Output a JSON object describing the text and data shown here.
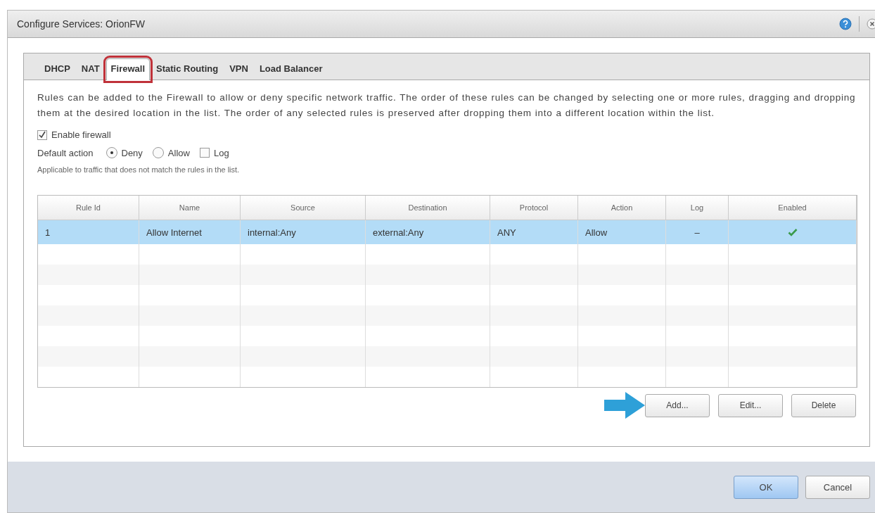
{
  "window": {
    "title": "Configure Services: OrionFW"
  },
  "tabs": [
    {
      "label": "DHCP",
      "selected": false,
      "highlighted": false
    },
    {
      "label": "NAT",
      "selected": false,
      "highlighted": false
    },
    {
      "label": "Firewall",
      "selected": true,
      "highlighted": true
    },
    {
      "label": "Static Routing",
      "selected": false,
      "highlighted": false
    },
    {
      "label": "VPN",
      "selected": false,
      "highlighted": false
    },
    {
      "label": "Load Balancer",
      "selected": false,
      "highlighted": false
    }
  ],
  "description": "Rules can be added to the Firewall to allow or deny specific network traffic. The order of these rules can be changed by selecting one or more rules, dragging and dropping them at the desired location in the list. The order of any selected rules is preserved after dropping them into a different location within the list.",
  "enable_firewall": {
    "label": "Enable firewall",
    "checked": true
  },
  "default_action": {
    "label": "Default action",
    "options": [
      {
        "label": "Deny",
        "selected": true
      },
      {
        "label": "Allow",
        "selected": false
      }
    ],
    "log": {
      "label": "Log",
      "checked": false
    }
  },
  "hint": "Applicable to traffic that does not match the rules in the list.",
  "table": {
    "columns": [
      "Rule Id",
      "Name",
      "Source",
      "Destination",
      "Protocol",
      "Action",
      "Log",
      "Enabled"
    ],
    "rows": [
      {
        "selected": true,
        "rule_id": "1",
        "name": "Allow Internet",
        "source": "internal:Any",
        "destination": "external:Any",
        "protocol": "ANY",
        "action": "Allow",
        "log": "–",
        "enabled": true
      }
    ]
  },
  "table_buttons": [
    {
      "label": "Add...",
      "pointed": true
    },
    {
      "label": "Edit...",
      "pointed": false
    },
    {
      "label": "Delete",
      "pointed": false
    }
  ],
  "footer_buttons": [
    {
      "label": "OK",
      "primary": true
    },
    {
      "label": "Cancel",
      "primary": false
    }
  ]
}
